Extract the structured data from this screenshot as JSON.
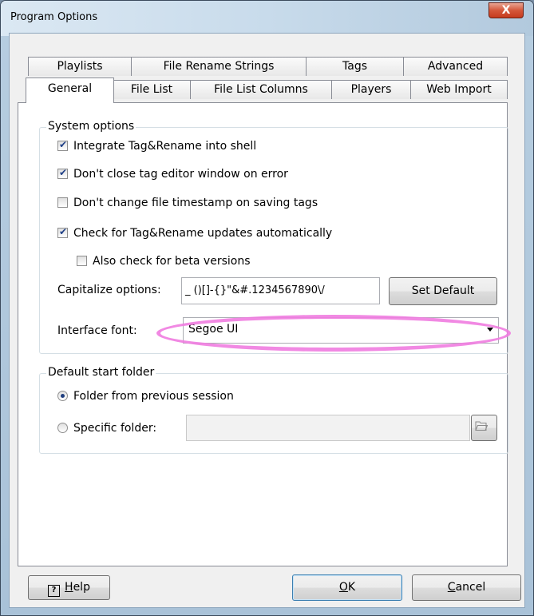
{
  "window": {
    "title": "Program Options",
    "close_symbol": "X"
  },
  "tabs": {
    "row1": [
      "Playlists",
      "File Rename Strings",
      "Tags",
      "Advanced"
    ],
    "row2": [
      "General",
      "File List",
      "File List Columns",
      "Players",
      "Web Import"
    ],
    "active": "General"
  },
  "system_options": {
    "legend": "System options",
    "integrate": {
      "label": "Integrate Tag&Rename into shell",
      "checked": true
    },
    "dont_close": {
      "label": "Don't close tag editor window on error",
      "checked": true
    },
    "dont_change": {
      "label": "Don't change file timestamp on saving tags",
      "checked": false
    },
    "check_updates": {
      "label": "Check for Tag&Rename updates automatically",
      "checked": true
    },
    "beta": {
      "label": "Also check for beta versions",
      "checked": false
    },
    "capitalize_label": "Capitalize options:",
    "capitalize_value": "_ ()[]-{}\"&#.1234567890\\/",
    "set_default_label": "Set Default",
    "font_label": "Interface font:",
    "font_value": "Segoe UI"
  },
  "start_folder": {
    "legend": "Default start folder",
    "previous": {
      "label": "Folder from previous session",
      "selected": true
    },
    "specific": {
      "label": "Specific folder:",
      "selected": false
    },
    "path_value": ""
  },
  "buttons": {
    "help": "Help",
    "help_accel": "H",
    "ok": "OK",
    "ok_accel": "O",
    "cancel": "Cancel",
    "cancel_accel": "C"
  },
  "colors": {
    "highlight_ring": "#f07ce0"
  }
}
